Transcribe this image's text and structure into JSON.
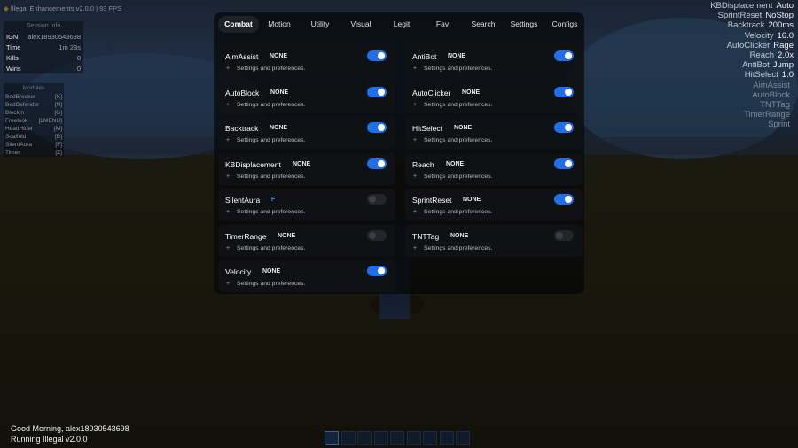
{
  "hud": {
    "brand": "Illegal Enhancements v2.0.0 | 93 FPS",
    "session": {
      "title": "Session Info",
      "rows": [
        {
          "label": "IGN",
          "value": "alex18930543698"
        },
        {
          "label": "Time",
          "value": "1m 23s"
        },
        {
          "label": "Kills",
          "value": "0"
        },
        {
          "label": "Wins",
          "value": "0"
        }
      ]
    },
    "modules": {
      "title": "Modules",
      "rows": [
        {
          "name": "BedBreaker",
          "key": "[K]"
        },
        {
          "name": "BedDefender",
          "key": "[N]"
        },
        {
          "name": "Blockin",
          "key": "[G]"
        },
        {
          "name": "Freelook",
          "key": "[LMENU]"
        },
        {
          "name": "HeadHitter",
          "key": "[M]"
        },
        {
          "name": "Scaffold",
          "key": "[B]"
        },
        {
          "name": "SilentAura",
          "key": "[F]"
        },
        {
          "name": "Timer",
          "key": "[Z]"
        }
      ]
    }
  },
  "arraylist": [
    {
      "name": "KBDisplacement",
      "value": "Auto"
    },
    {
      "name": "SprintReset",
      "value": "NoStop"
    },
    {
      "name": "Backtrack",
      "value": "200ms"
    },
    {
      "name": "Velocity",
      "value": "16.0"
    },
    {
      "name": "AutoClicker",
      "value": "Rage"
    },
    {
      "name": "Reach",
      "value": "2.0x"
    },
    {
      "name": "AntiBot",
      "value": "Jump"
    },
    {
      "name": "HitSelect",
      "value": "1.0"
    },
    {
      "name": "AimAssist",
      "value": ""
    },
    {
      "name": "AutoBlock",
      "value": ""
    },
    {
      "name": "TNTTag",
      "value": ""
    },
    {
      "name": "TimerRange",
      "value": ""
    },
    {
      "name": "Sprint",
      "value": ""
    }
  ],
  "tabs": [
    "Combat",
    "Motion",
    "Utility",
    "Visual",
    "Legit",
    "Fav",
    "Search",
    "Settings",
    "Configs"
  ],
  "active_tab": "Combat",
  "settings_label": "Settings and preferences.",
  "modules_left": [
    {
      "name": "AimAssist",
      "key": "NONE",
      "enabled": true
    },
    {
      "name": "AutoBlock",
      "key": "NONE",
      "enabled": true
    },
    {
      "name": "Backtrack",
      "key": "NONE",
      "enabled": true
    },
    {
      "name": "KBDisplacement",
      "key": "NONE",
      "enabled": true
    },
    {
      "name": "SilentAura",
      "key": "F",
      "enabled": false
    },
    {
      "name": "TimerRange",
      "key": "NONE",
      "enabled": false
    },
    {
      "name": "Velocity",
      "key": "NONE",
      "enabled": true
    }
  ],
  "modules_right": [
    {
      "name": "AntiBot",
      "key": "NONE",
      "enabled": true
    },
    {
      "name": "AutoClicker",
      "key": "NONE",
      "enabled": true
    },
    {
      "name": "HitSelect",
      "key": "NONE",
      "enabled": true
    },
    {
      "name": "Reach",
      "key": "NONE",
      "enabled": true
    },
    {
      "name": "SprintReset",
      "key": "NONE",
      "enabled": true
    },
    {
      "name": "TNTTag",
      "key": "NONE",
      "enabled": false
    }
  ],
  "greeting": {
    "line1": "Good Morning, alex18930543698",
    "line2": "Running Illegal v2.0.0"
  },
  "hotbar": {
    "slots": 9,
    "selected": 0
  },
  "colors": {
    "accent": "#1f6fea",
    "key_bind_active": "#3d8bff"
  }
}
